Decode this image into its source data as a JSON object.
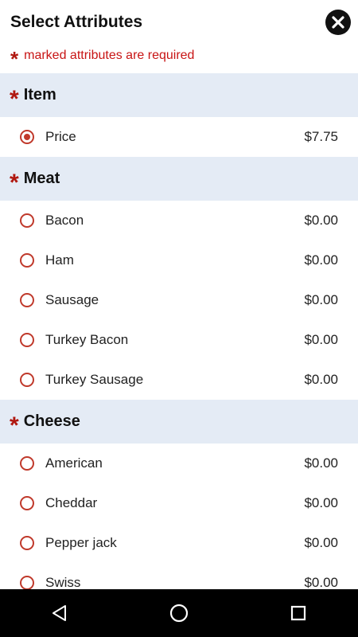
{
  "header": {
    "title": "Select Attributes",
    "required_note": "marked attributes are required",
    "required_marker": "*"
  },
  "colors": {
    "accent": "#c0392b",
    "section_bg": "#e4ebf5",
    "required_red": "#b0170f"
  },
  "sections": [
    {
      "title": "Item",
      "required": true,
      "options": [
        {
          "label": "Price",
          "price": "$7.75",
          "selected": true
        }
      ]
    },
    {
      "title": "Meat",
      "required": true,
      "options": [
        {
          "label": "Bacon",
          "price": "$0.00",
          "selected": false
        },
        {
          "label": "Ham",
          "price": "$0.00",
          "selected": false
        },
        {
          "label": "Sausage",
          "price": "$0.00",
          "selected": false
        },
        {
          "label": "Turkey Bacon",
          "price": "$0.00",
          "selected": false
        },
        {
          "label": "Turkey Sausage",
          "price": "$0.00",
          "selected": false
        }
      ]
    },
    {
      "title": "Cheese",
      "required": true,
      "options": [
        {
          "label": "American",
          "price": "$0.00",
          "selected": false
        },
        {
          "label": "Cheddar",
          "price": "$0.00",
          "selected": false
        },
        {
          "label": "Pepper jack",
          "price": "$0.00",
          "selected": false
        },
        {
          "label": "Swiss",
          "price": "$0.00",
          "selected": false
        }
      ]
    }
  ],
  "icons": {
    "close": "close-icon",
    "back": "back-triangle-icon",
    "home": "home-circle-icon",
    "recents": "recents-square-icon"
  }
}
